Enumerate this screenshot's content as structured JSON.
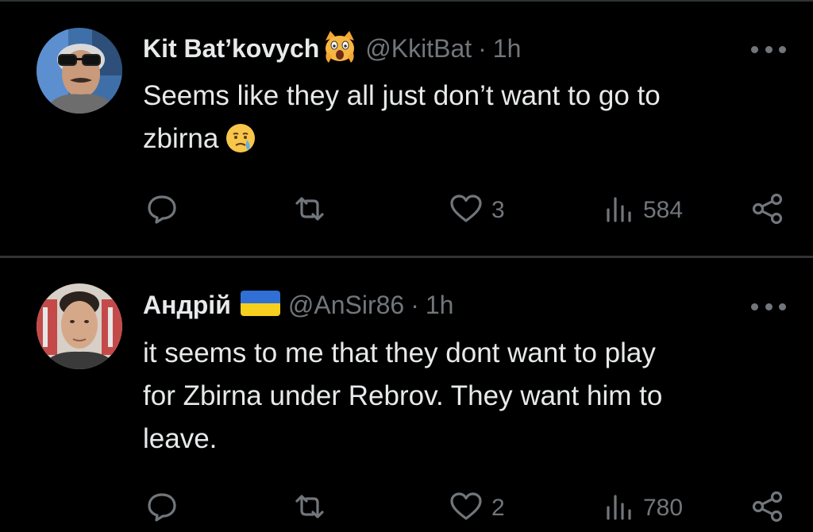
{
  "tweets": [
    {
      "display_name": "Kit Bat’kovych",
      "name_badge": "screaming-cat-emoji",
      "handle": "@KkitBat",
      "separator": "·",
      "time": "1h",
      "text_lines": [
        "Seems like they all just don’t want to go to",
        "zbirna"
      ],
      "text_emoji": "face-holding-back-tears-emoji",
      "replies": "",
      "retweets": "",
      "likes": "3",
      "views": "584"
    },
    {
      "display_name": "Андрій",
      "name_badge": "ukraine-flag-emoji",
      "handle": "@AnSir86",
      "separator": "·",
      "time": "1h",
      "text_lines": [
        "it seems to me that they dont want to play",
        "for Zbirna under Rebrov. They want him to",
        "leave."
      ],
      "replies": "",
      "retweets": "",
      "likes": "2",
      "views": "780"
    }
  ],
  "colors": {
    "background": "#000000",
    "text_primary": "#e7e9ea",
    "text_secondary": "#71767b",
    "divider": "#2f3336"
  },
  "icons": [
    "reply-icon",
    "retweet-icon",
    "like-icon",
    "views-icon",
    "share-icon",
    "more-icon"
  ]
}
